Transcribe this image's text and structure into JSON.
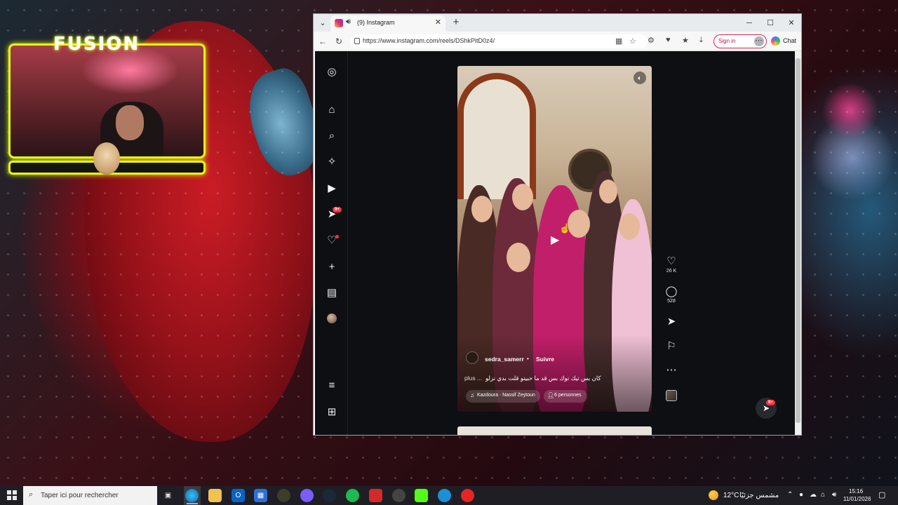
{
  "stream_overlay": {
    "title": "FUSION",
    "colors": {
      "frame": "#e8f51a",
      "glow": "#d4ff00"
    }
  },
  "browser": {
    "tab": {
      "title": "(9) Instagram",
      "favicon": "instagram-icon",
      "audio": "speaker-icon"
    },
    "url": "https://www.instagram.com/reels/DShkPitD0z4/",
    "sign_in_label": "Sign in",
    "chat_label": "Chat",
    "window_controls": [
      "─",
      "☐",
      "✕"
    ]
  },
  "instagram": {
    "sidebar": {
      "items": [
        {
          "name": "home",
          "icon": "home-icon"
        },
        {
          "name": "search",
          "icon": "search-icon"
        },
        {
          "name": "explore",
          "icon": "compass-icon"
        },
        {
          "name": "reels",
          "icon": "reels-icon"
        },
        {
          "name": "messages",
          "icon": "send-icon",
          "badge": "9+"
        },
        {
          "name": "notifications",
          "icon": "heart-icon",
          "dot": true
        },
        {
          "name": "create",
          "icon": "plus-icon"
        },
        {
          "name": "dashboard",
          "icon": "chart-icon"
        },
        {
          "name": "profile",
          "icon": "avatar"
        }
      ],
      "bottom": [
        "menu-icon",
        "apps-icon"
      ]
    },
    "reel": {
      "username": "sedra_samerr",
      "follow_label": "Suivre",
      "separator": "•",
      "caption": "كان بس تيك توك بس قد ما حبيتو قلت بدي نزلو",
      "more_label": "plus ...",
      "music": "Kazdoura · Nassif Zeytoun",
      "people": "6 personnes"
    },
    "actions": {
      "likes": "26 K",
      "comments": "528"
    },
    "messages_badge": "9+"
  },
  "taskbar": {
    "search_placeholder": "Taper ici pour rechercher",
    "weather_temp": "12°C",
    "weather_desc": "مشمس جزئيًا",
    "time": "15:16",
    "date": "11/01/2026"
  }
}
